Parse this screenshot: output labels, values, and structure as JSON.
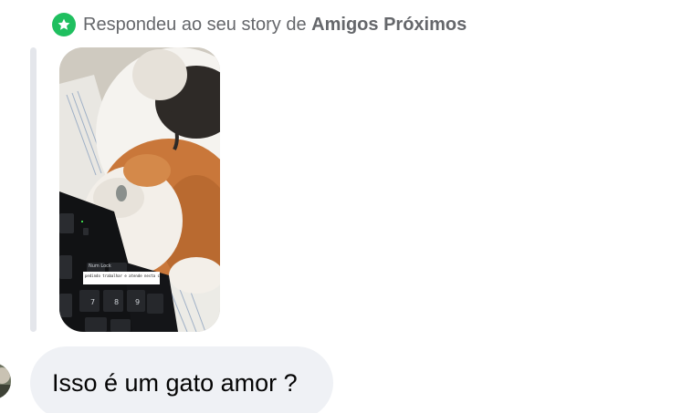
{
  "reply_header": {
    "prefix": "Respondeu ao seu story de",
    "audience": "Amigos Próximos",
    "badge_icon": "star-icon",
    "badge_color": "#1fbf5f"
  },
  "story": {
    "overlay_text": "pedindo trabalhar e atende nesta casa",
    "keyboard_keys": [
      "Num Lock",
      "7",
      "8",
      "9"
    ]
  },
  "message": {
    "text": "Isso é um gato amor ?",
    "bubble_color": "#eff1f5"
  }
}
